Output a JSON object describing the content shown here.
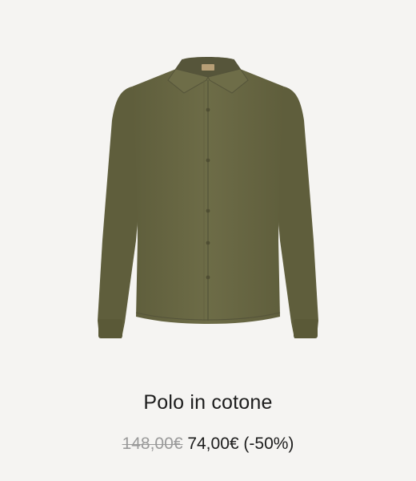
{
  "product": {
    "name": "Polo in cotone",
    "price_old": "148,00€",
    "price_new": "74,00€",
    "discount": "(-50%)",
    "image_alt": "Polo in cotone",
    "garment_color": "#6b6a45"
  },
  "colors": {
    "background": "#f5f4f2",
    "text": "#1c1c1c",
    "old_price": "#9a9a9a"
  }
}
